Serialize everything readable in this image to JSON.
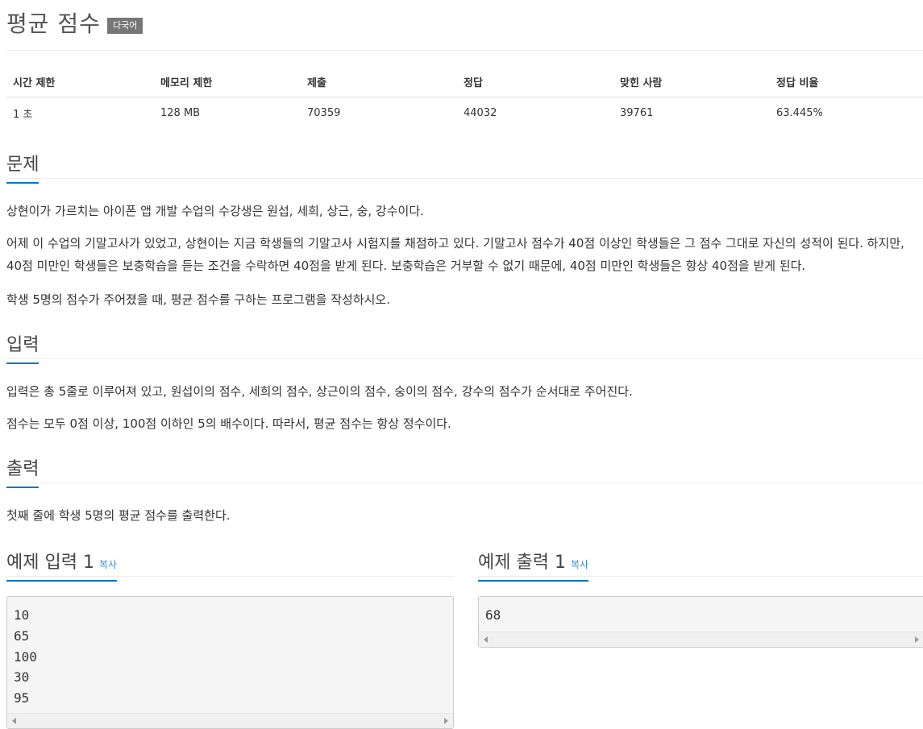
{
  "problem": {
    "title": "평균 점수",
    "lang_badge": "다국어"
  },
  "stats": {
    "headers": [
      "시간 제한",
      "메모리 제한",
      "제출",
      "정답",
      "맞힌 사람",
      "정답 비율"
    ],
    "values": [
      "1 초",
      "128 MB",
      "70359",
      "44032",
      "39761",
      "63.445%"
    ]
  },
  "sections": {
    "description": {
      "heading": "문제",
      "paragraphs": [
        "상현이가 가르치는 아이폰 앱 개발 수업의 수강생은 원섭, 세희, 상근, 숭, 강수이다.",
        "어제 이 수업의 기말고사가 있었고, 상현이는 지금 학생들의 기말고사 시험지를 채점하고 있다. 기말고사 점수가 40점 이상인 학생들은 그 점수 그대로 자신의 성적이 된다. 하지만, 40점 미만인 학생들은 보충학습을 듣는 조건을 수락하면 40점을 받게 된다. 보충학습은 거부할 수 없기 때문에, 40점 미만인 학생들은 항상 40점을 받게 된다.",
        "학생 5명의 점수가 주어졌을 때, 평균 점수를 구하는 프로그램을 작성하시오."
      ]
    },
    "input": {
      "heading": "입력",
      "paragraphs": [
        "입력은 총 5줄로 이루어져 있고, 원섭이의 점수, 세희의 점수, 상근이의 점수, 숭이의 점수, 강수의 점수가 순서대로 주어진다.",
        "점수는 모두 0점 이상, 100점 이하인 5의 배수이다. 따라서, 평균 점수는 항상 정수이다."
      ]
    },
    "output": {
      "heading": "출력",
      "paragraphs": [
        "첫째 줄에 학생 5명의 평균 점수를 출력한다."
      ]
    }
  },
  "samples": {
    "input": {
      "heading": "예제 입력 1",
      "copy_label": "복사",
      "content": "10\n65\n100\n30\n95"
    },
    "output": {
      "heading": "예제 출력 1",
      "copy_label": "복사",
      "content": "68"
    }
  },
  "colors": {
    "accent": "#0076c0",
    "link": "#428bca",
    "badge": "#777777"
  }
}
